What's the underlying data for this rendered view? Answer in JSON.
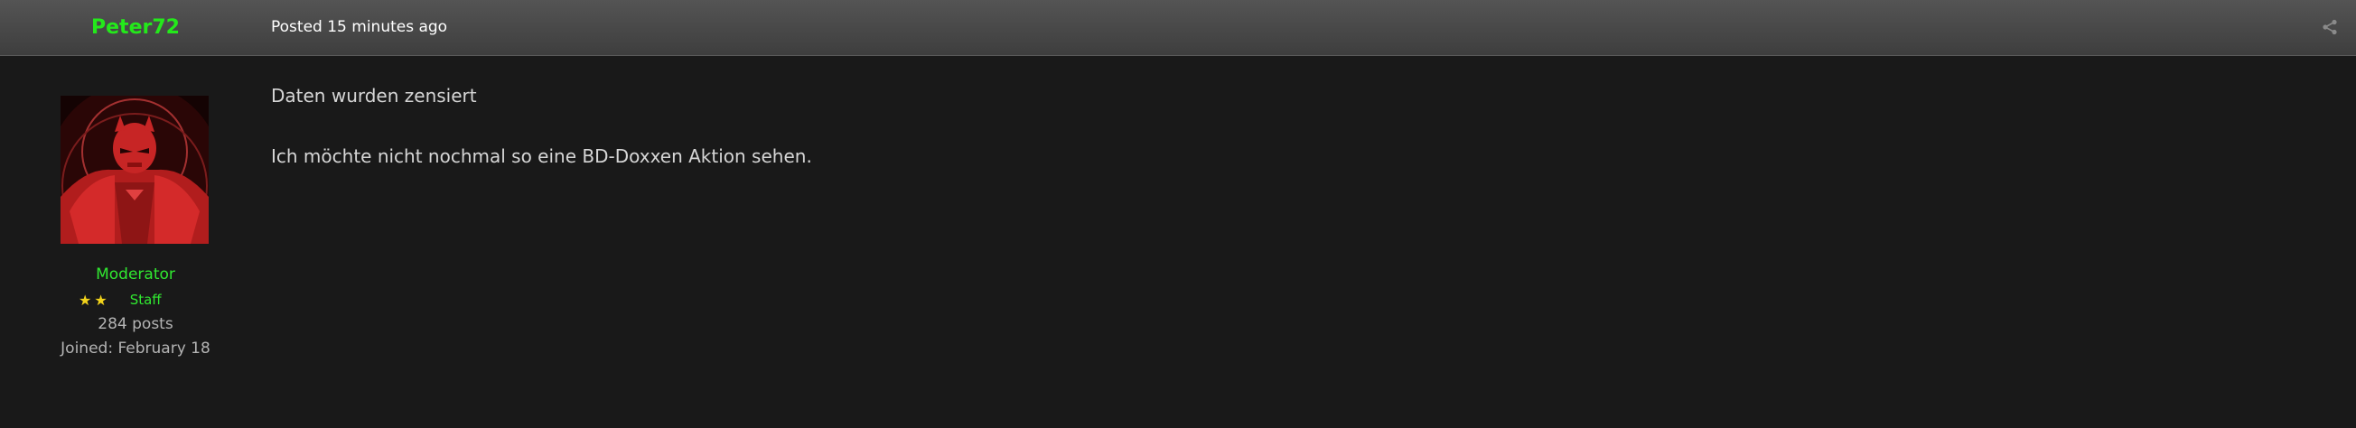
{
  "post": {
    "author": {
      "name": "Peter72",
      "role": "Moderator",
      "stars": "★★",
      "group": "Staff",
      "posts": "284 posts",
      "joined": "Joined: February 18"
    },
    "meta": {
      "posted": "Posted 15 minutes ago"
    },
    "content": [
      "Daten wurden zensiert",
      "Ich möchte nicht nochmal so eine BD-Doxxen Aktion sehen."
    ],
    "share_icon": "share-icon"
  },
  "colors": {
    "username": "#24e91b",
    "role": "#30e830",
    "stars": "#f2d31b",
    "background": "#191919",
    "header": "#4a4a4a"
  }
}
